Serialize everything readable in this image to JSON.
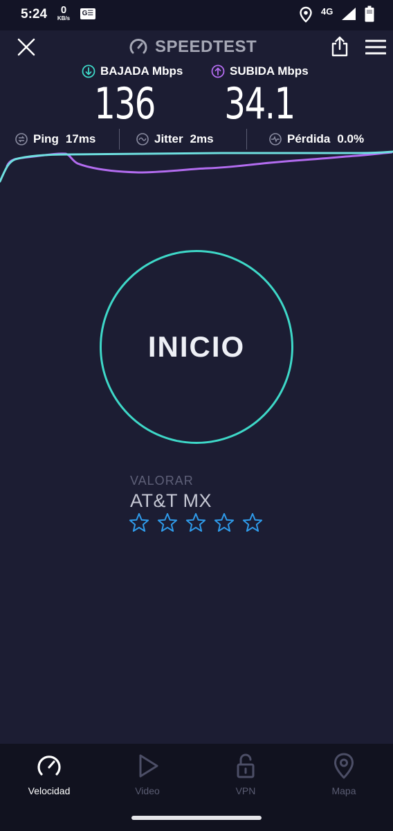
{
  "status_bar": {
    "time": "5:24",
    "net_speed_value": "0",
    "net_speed_unit": "KB/s",
    "app_badge": "G☰",
    "network": "4G"
  },
  "header": {
    "title": "SPEEDTEST"
  },
  "download": {
    "label": "BAJADA Mbps",
    "value": "136",
    "color": "#3ed8c8"
  },
  "upload": {
    "label": "SUBIDA Mbps",
    "value": "34.1",
    "color": "#b36cf0"
  },
  "stats": {
    "ping_label": "Ping",
    "ping_value": "17ms",
    "jitter_label": "Jitter",
    "jitter_value": "2ms",
    "loss_label": "Pérdida",
    "loss_value": "0.0%"
  },
  "start_button": {
    "label": "INICIO",
    "ring_color": "#3ed8c8"
  },
  "rating": {
    "label": "VALORAR",
    "provider": "AT&T MX",
    "star_count": 5,
    "star_color": "#2f9bea"
  },
  "bottom_nav": {
    "items": [
      {
        "label": "Velocidad",
        "icon": "speedometer-icon",
        "active": true
      },
      {
        "label": "Video",
        "icon": "play-icon",
        "active": false
      },
      {
        "label": "VPN",
        "icon": "unlock-icon",
        "active": false
      },
      {
        "label": "Mapa",
        "icon": "map-pin-icon",
        "active": false
      }
    ]
  }
}
